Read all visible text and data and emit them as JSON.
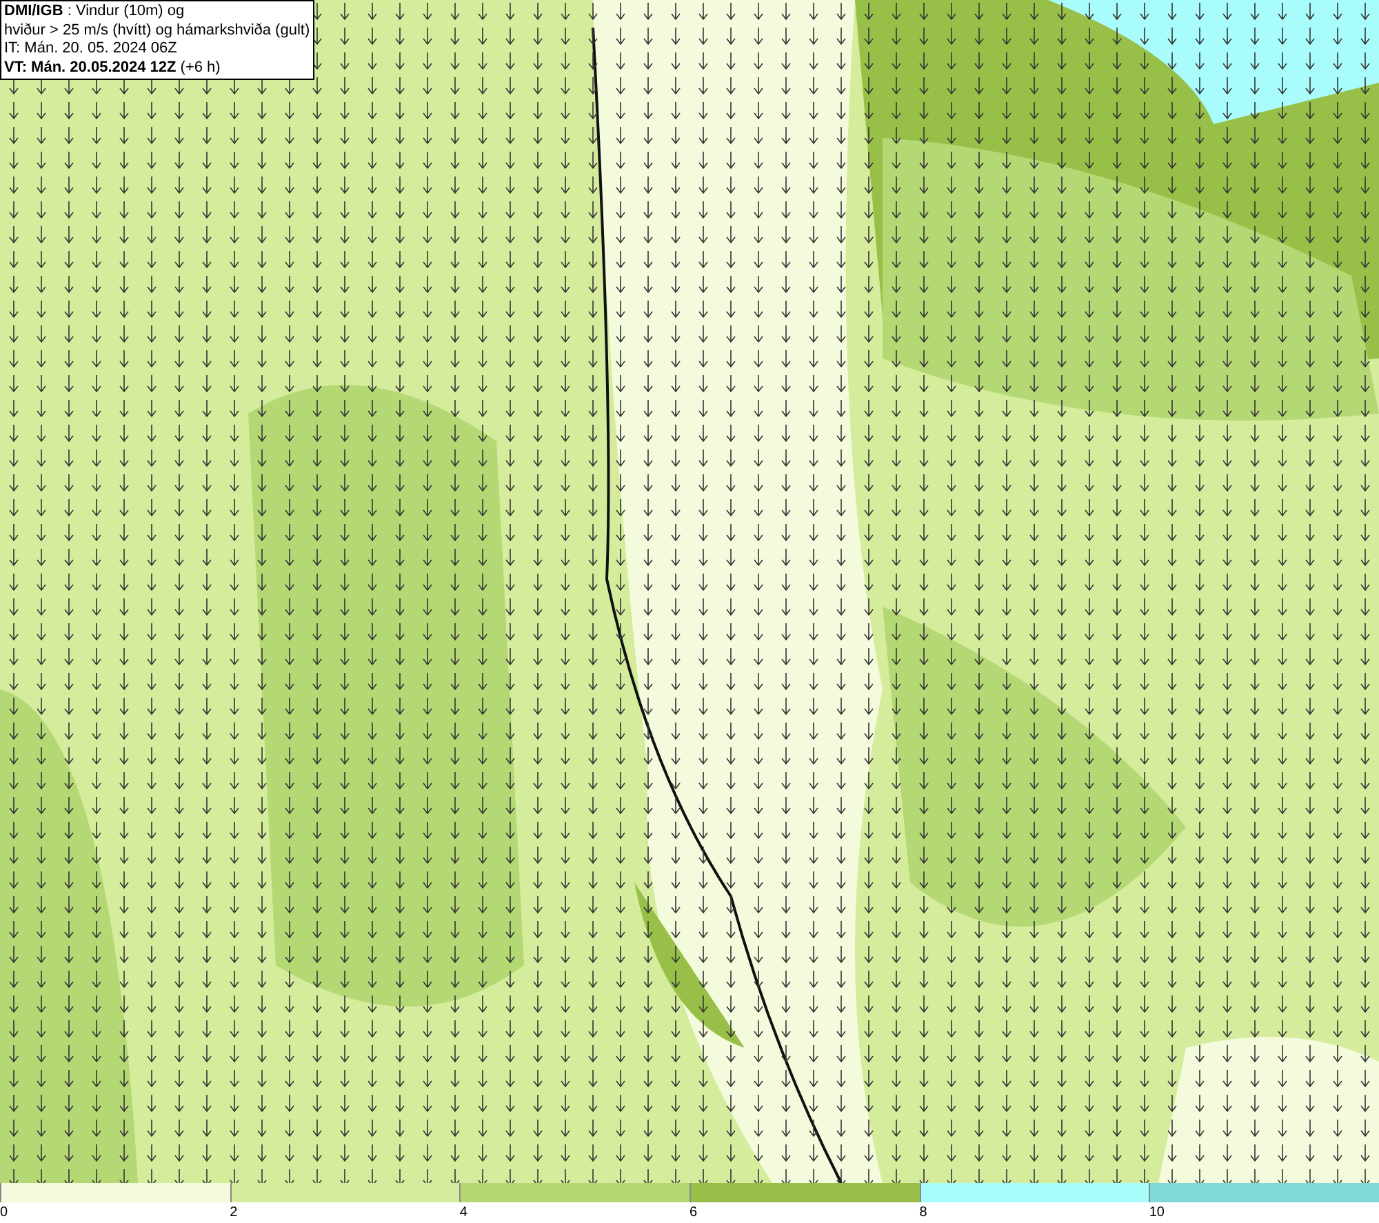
{
  "header": {
    "lines": [
      "**DMI/IGB** : Vindur (10m) og",
      "hviður > 25 m/s (hvítt) og hámarkshviða (gult)",
      "IT: Mán. 20. 05. 2024 06Z",
      "**VT: Mán. 20.05.2024 12Z** (+6 h)"
    ]
  },
  "legend": {
    "bins": [
      {
        "label": "0",
        "color": "#f4fbdc"
      },
      {
        "label": "2",
        "color": "#d4ec9c"
      },
      {
        "label": "4",
        "color": "#b4d874"
      },
      {
        "label": "6",
        "color": "#98c048"
      },
      {
        "label": "8",
        "color": "#a8fcfc"
      },
      {
        "label": "10",
        "color": "#80d8d8"
      }
    ]
  }
}
